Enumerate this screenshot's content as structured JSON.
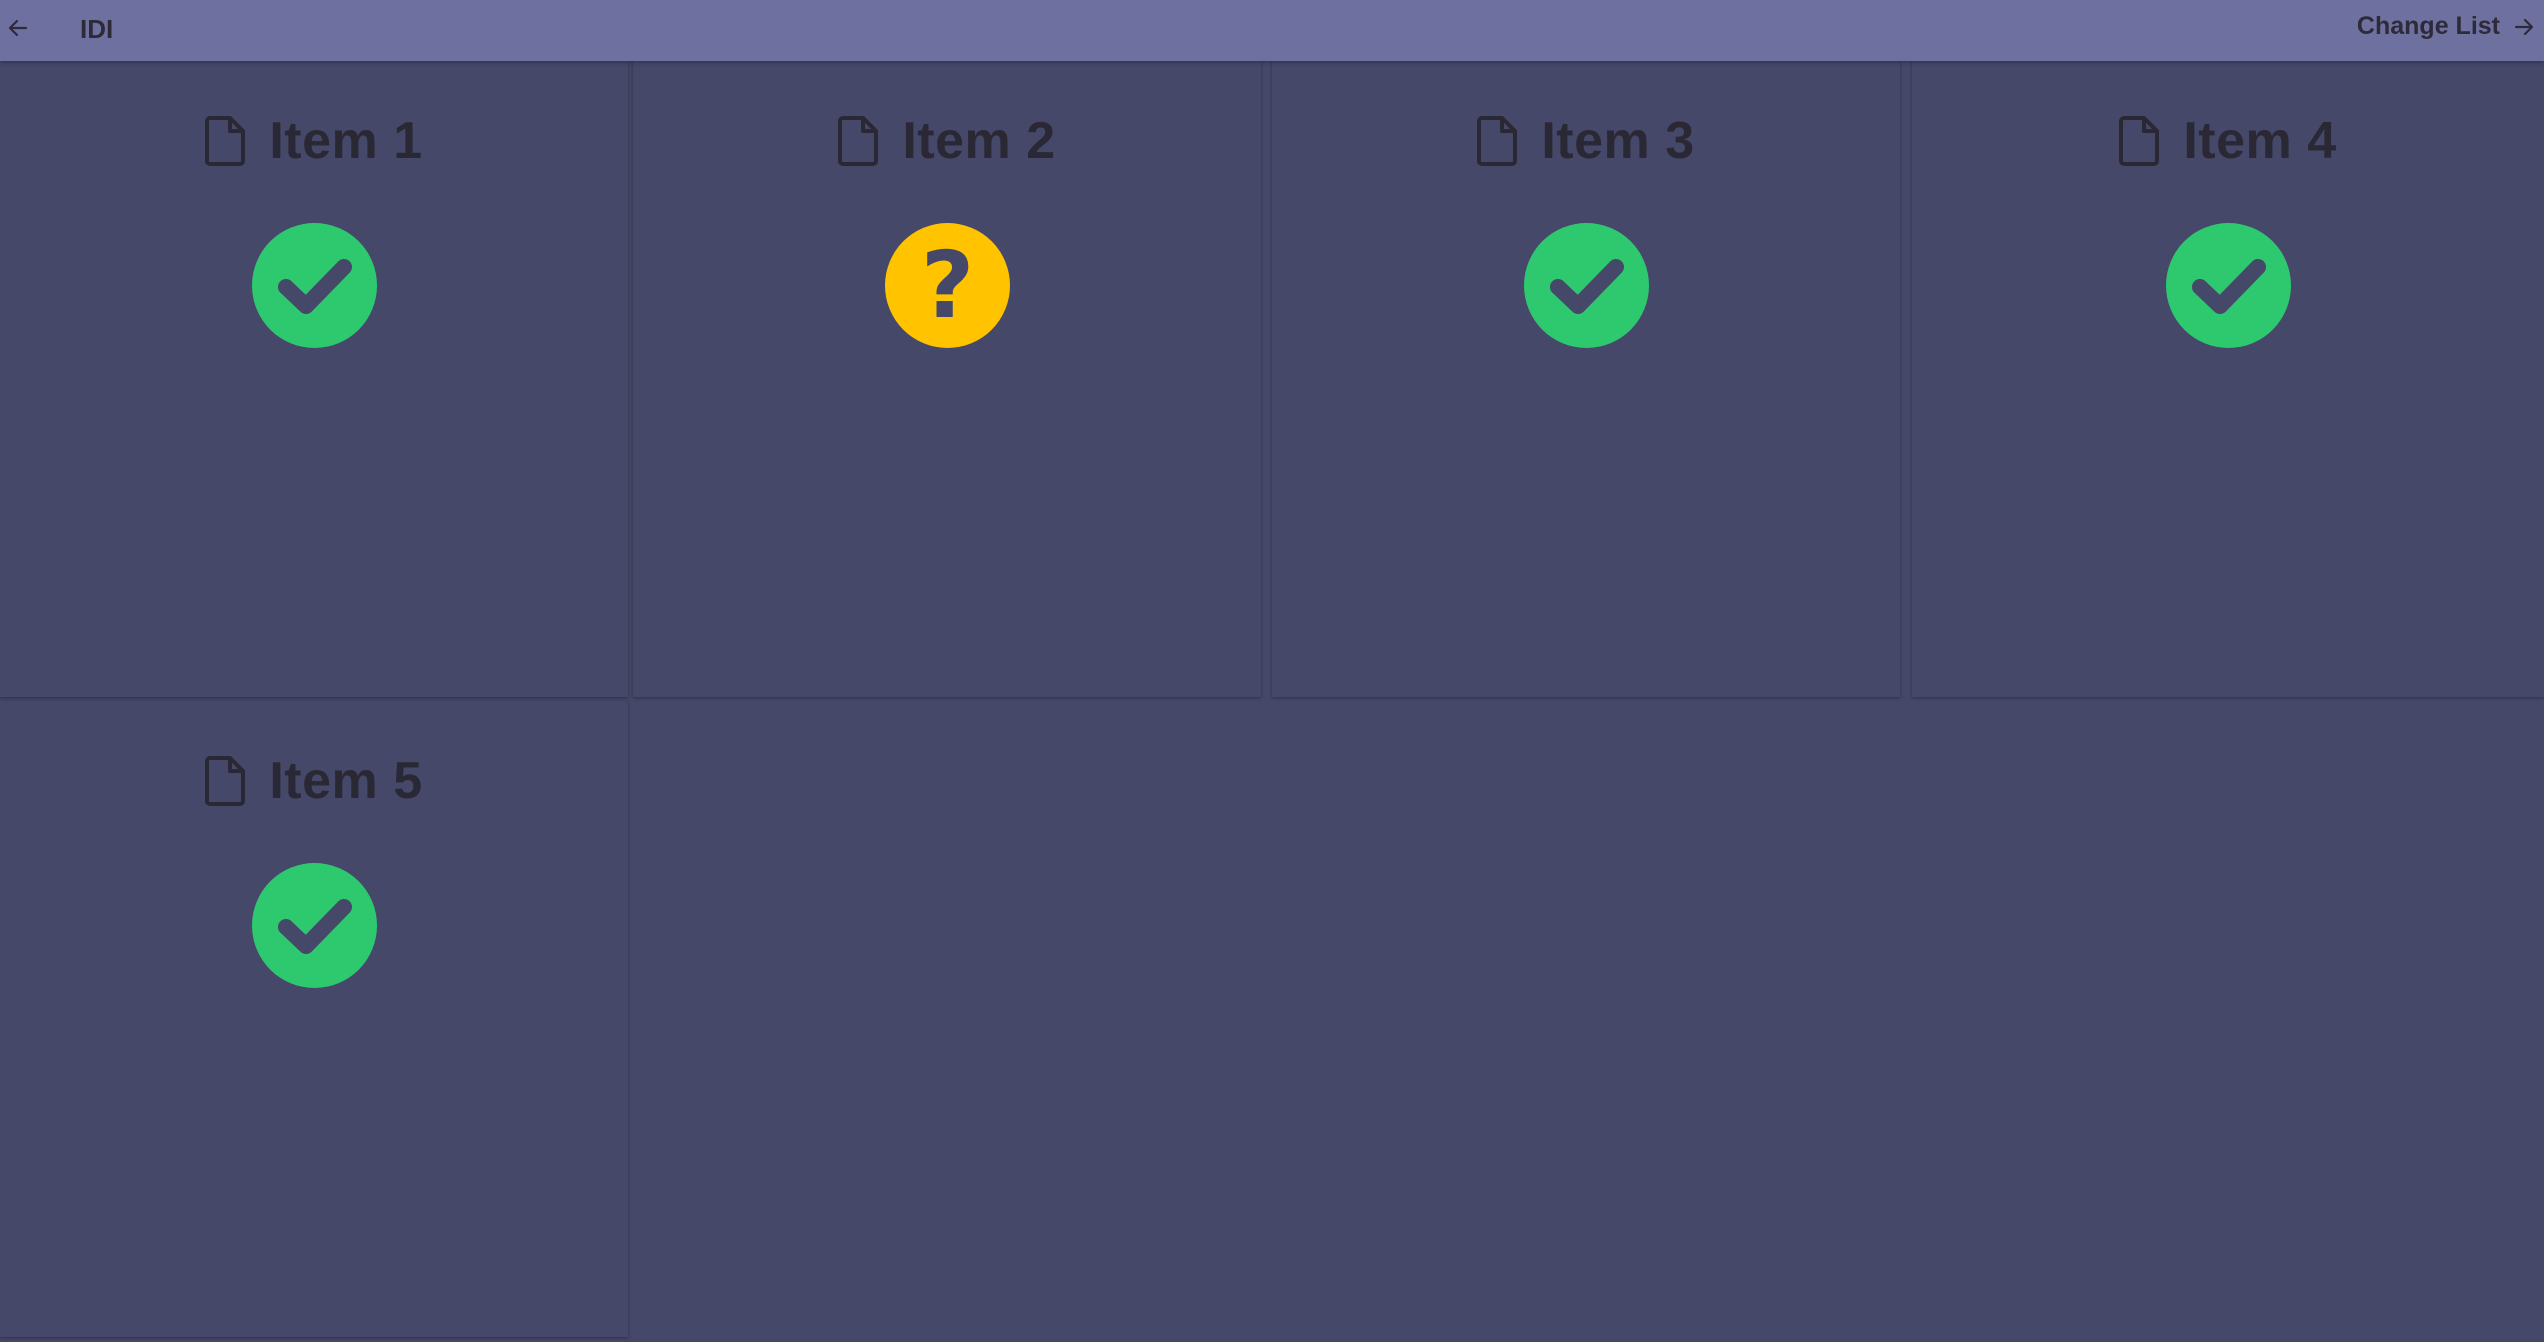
{
  "header": {
    "title": "IDI",
    "back_icon": "arrow-left-icon",
    "change_list_label": "Change List",
    "change_list_icon": "arrow-right-icon"
  },
  "items": [
    {
      "label": "Item 1",
      "icon": "file-icon",
      "status": "ok"
    },
    {
      "label": "Item 2",
      "icon": "file-icon",
      "status": "unknown"
    },
    {
      "label": "Item 3",
      "icon": "file-icon",
      "status": "ok"
    },
    {
      "label": "Item 4",
      "icon": "file-icon",
      "status": "ok"
    },
    {
      "label": "Item 5",
      "icon": "file-icon",
      "status": "ok"
    }
  ],
  "colors": {
    "header_bg": "#6e70a0",
    "page_bg": "#454869",
    "status_ok": "#2ec96f",
    "status_unknown": "#ffc300"
  }
}
